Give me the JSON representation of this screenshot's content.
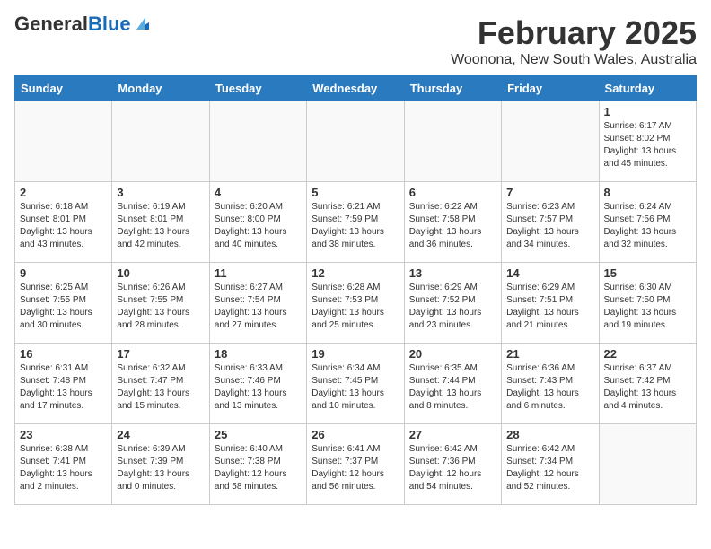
{
  "header": {
    "logo_general": "General",
    "logo_blue": "Blue",
    "month_title": "February 2025",
    "location": "Woonona, New South Wales, Australia"
  },
  "weekdays": [
    "Sunday",
    "Monday",
    "Tuesday",
    "Wednesday",
    "Thursday",
    "Friday",
    "Saturday"
  ],
  "weeks": [
    [
      {
        "day": "",
        "info": ""
      },
      {
        "day": "",
        "info": ""
      },
      {
        "day": "",
        "info": ""
      },
      {
        "day": "",
        "info": ""
      },
      {
        "day": "",
        "info": ""
      },
      {
        "day": "",
        "info": ""
      },
      {
        "day": "1",
        "info": "Sunrise: 6:17 AM\nSunset: 8:02 PM\nDaylight: 13 hours\nand 45 minutes."
      }
    ],
    [
      {
        "day": "2",
        "info": "Sunrise: 6:18 AM\nSunset: 8:01 PM\nDaylight: 13 hours\nand 43 minutes."
      },
      {
        "day": "3",
        "info": "Sunrise: 6:19 AM\nSunset: 8:01 PM\nDaylight: 13 hours\nand 42 minutes."
      },
      {
        "day": "4",
        "info": "Sunrise: 6:20 AM\nSunset: 8:00 PM\nDaylight: 13 hours\nand 40 minutes."
      },
      {
        "day": "5",
        "info": "Sunrise: 6:21 AM\nSunset: 7:59 PM\nDaylight: 13 hours\nand 38 minutes."
      },
      {
        "day": "6",
        "info": "Sunrise: 6:22 AM\nSunset: 7:58 PM\nDaylight: 13 hours\nand 36 minutes."
      },
      {
        "day": "7",
        "info": "Sunrise: 6:23 AM\nSunset: 7:57 PM\nDaylight: 13 hours\nand 34 minutes."
      },
      {
        "day": "8",
        "info": "Sunrise: 6:24 AM\nSunset: 7:56 PM\nDaylight: 13 hours\nand 32 minutes."
      }
    ],
    [
      {
        "day": "9",
        "info": "Sunrise: 6:25 AM\nSunset: 7:55 PM\nDaylight: 13 hours\nand 30 minutes."
      },
      {
        "day": "10",
        "info": "Sunrise: 6:26 AM\nSunset: 7:55 PM\nDaylight: 13 hours\nand 28 minutes."
      },
      {
        "day": "11",
        "info": "Sunrise: 6:27 AM\nSunset: 7:54 PM\nDaylight: 13 hours\nand 27 minutes."
      },
      {
        "day": "12",
        "info": "Sunrise: 6:28 AM\nSunset: 7:53 PM\nDaylight: 13 hours\nand 25 minutes."
      },
      {
        "day": "13",
        "info": "Sunrise: 6:29 AM\nSunset: 7:52 PM\nDaylight: 13 hours\nand 23 minutes."
      },
      {
        "day": "14",
        "info": "Sunrise: 6:29 AM\nSunset: 7:51 PM\nDaylight: 13 hours\nand 21 minutes."
      },
      {
        "day": "15",
        "info": "Sunrise: 6:30 AM\nSunset: 7:50 PM\nDaylight: 13 hours\nand 19 minutes."
      }
    ],
    [
      {
        "day": "16",
        "info": "Sunrise: 6:31 AM\nSunset: 7:48 PM\nDaylight: 13 hours\nand 17 minutes."
      },
      {
        "day": "17",
        "info": "Sunrise: 6:32 AM\nSunset: 7:47 PM\nDaylight: 13 hours\nand 15 minutes."
      },
      {
        "day": "18",
        "info": "Sunrise: 6:33 AM\nSunset: 7:46 PM\nDaylight: 13 hours\nand 13 minutes."
      },
      {
        "day": "19",
        "info": "Sunrise: 6:34 AM\nSunset: 7:45 PM\nDaylight: 13 hours\nand 10 minutes."
      },
      {
        "day": "20",
        "info": "Sunrise: 6:35 AM\nSunset: 7:44 PM\nDaylight: 13 hours\nand 8 minutes."
      },
      {
        "day": "21",
        "info": "Sunrise: 6:36 AM\nSunset: 7:43 PM\nDaylight: 13 hours\nand 6 minutes."
      },
      {
        "day": "22",
        "info": "Sunrise: 6:37 AM\nSunset: 7:42 PM\nDaylight: 13 hours\nand 4 minutes."
      }
    ],
    [
      {
        "day": "23",
        "info": "Sunrise: 6:38 AM\nSunset: 7:41 PM\nDaylight: 13 hours\nand 2 minutes."
      },
      {
        "day": "24",
        "info": "Sunrise: 6:39 AM\nSunset: 7:39 PM\nDaylight: 13 hours\nand 0 minutes."
      },
      {
        "day": "25",
        "info": "Sunrise: 6:40 AM\nSunset: 7:38 PM\nDaylight: 12 hours\nand 58 minutes."
      },
      {
        "day": "26",
        "info": "Sunrise: 6:41 AM\nSunset: 7:37 PM\nDaylight: 12 hours\nand 56 minutes."
      },
      {
        "day": "27",
        "info": "Sunrise: 6:42 AM\nSunset: 7:36 PM\nDaylight: 12 hours\nand 54 minutes."
      },
      {
        "day": "28",
        "info": "Sunrise: 6:42 AM\nSunset: 7:34 PM\nDaylight: 12 hours\nand 52 minutes."
      },
      {
        "day": "",
        "info": ""
      }
    ]
  ]
}
